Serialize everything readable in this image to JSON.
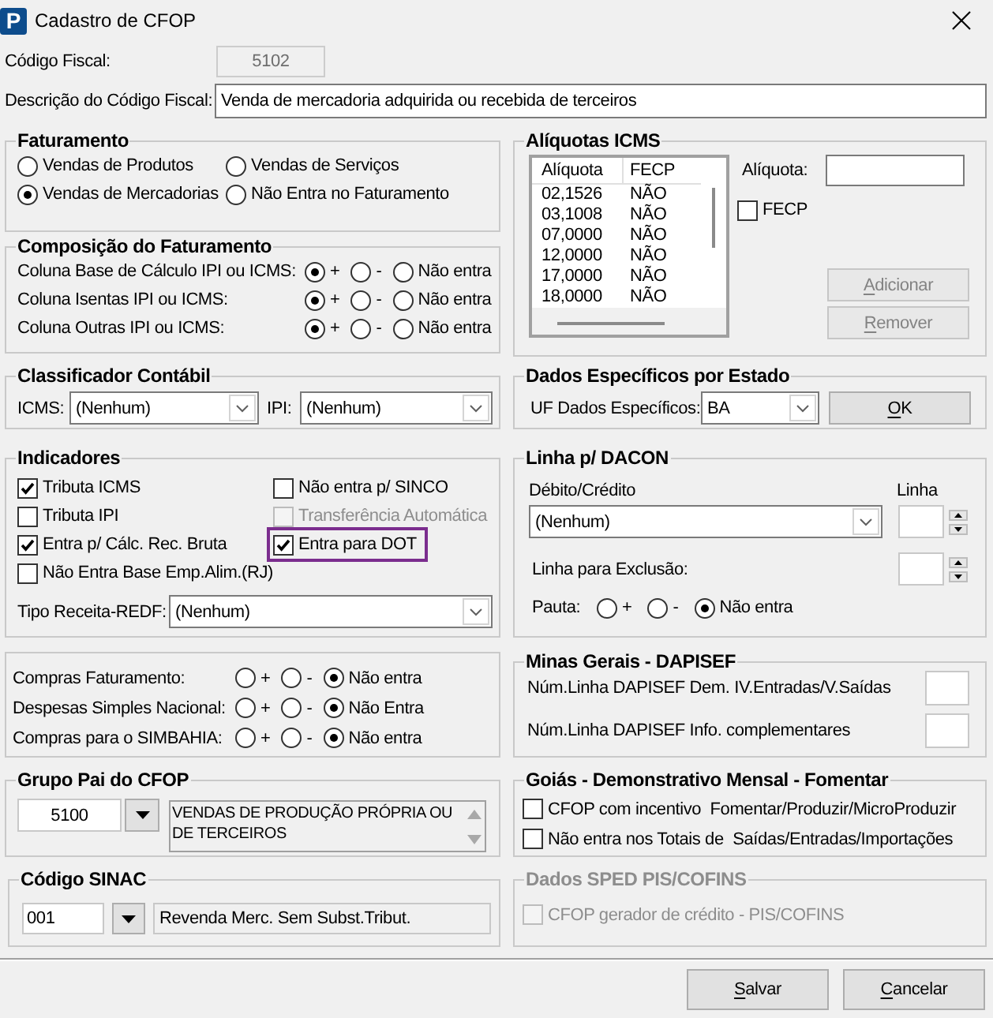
{
  "window": {
    "logo": "P",
    "title": "Cadastro de CFOP"
  },
  "header_fields": [
    {
      "label": "Código Fiscal:",
      "value": "5102",
      "disabled": true
    },
    {
      "label": "Descrição do Código Fiscal:",
      "value": "Venda de mercadoria adquirida ou recebida de terceiros",
      "disabled": false
    }
  ],
  "faturamento": {
    "title": "Faturamento",
    "options": [
      {
        "label": "Vendas de Produtos",
        "selected": false
      },
      {
        "label": "Vendas de Serviços",
        "selected": false
      },
      {
        "label": "Vendas de Mercadorias",
        "selected": true
      },
      {
        "label": "Não Entra no Faturamento",
        "selected": false
      }
    ]
  },
  "composicao": {
    "title": "Composição do Faturamento",
    "rows": [
      {
        "label": "Coluna Base de Cálculo IPI ou ICMS:",
        "options": [
          {
            "label": "+",
            "selected": true
          },
          {
            "label": "-",
            "selected": false
          },
          {
            "label": "Não entra",
            "selected": false
          }
        ]
      },
      {
        "label": "Coluna Isentas IPI ou ICMS:",
        "options": [
          {
            "label": "+",
            "selected": true
          },
          {
            "label": "-",
            "selected": false
          },
          {
            "label": "Não entra",
            "selected": false
          }
        ]
      },
      {
        "label": "Coluna Outras IPI ou ICMS:",
        "options": [
          {
            "label": "+",
            "selected": true
          },
          {
            "label": "-",
            "selected": false
          },
          {
            "label": "Não entra",
            "selected": false
          }
        ]
      }
    ]
  },
  "aliquotas_icms": {
    "title": "Alíquotas ICMS",
    "table": {
      "columns": [
        "Alíquota",
        "FECP"
      ],
      "rows": [
        [
          "02,1526",
          "NÃO"
        ],
        [
          "03,1008",
          "NÃO"
        ],
        [
          "07,0000",
          "NÃO"
        ],
        [
          "12,0000",
          "NÃO"
        ],
        [
          "17,0000",
          "NÃO"
        ],
        [
          "18,0000",
          "NÃO"
        ]
      ]
    },
    "aliquota_field": {
      "label": "Alíquota:"
    },
    "fecp": {
      "label": "FECP",
      "checked": false
    },
    "buttons": [
      {
        "label": "Adicionar",
        "disabled": true,
        "mnemonic": true
      },
      {
        "label": "Remover",
        "disabled": true,
        "mnemonic": true
      }
    ]
  },
  "classificador_contabil": {
    "title": "Classificador Contábil",
    "fields": [
      {
        "label": "ICMS:",
        "value": "(Nenhum)"
      },
      {
        "label": "IPI:",
        "value": "(Nenhum)"
      }
    ]
  },
  "dados_por_estado": {
    "title": "Dados Específicos por Estado",
    "label": "UF Dados Específicos:",
    "value": "BA",
    "button": {
      "label": "OK",
      "mnemonic": true,
      "disabled": false
    }
  },
  "indicadores": {
    "title": "Indicadores",
    "checkboxes": [
      {
        "label": "Tributa ICMS",
        "checked": true,
        "disabled": false,
        "highlighted": false
      },
      {
        "label": "Não entra p/ SINCO",
        "checked": false,
        "disabled": false,
        "highlighted": false
      },
      {
        "label": "Tributa IPI",
        "checked": false,
        "disabled": false,
        "highlighted": false
      },
      {
        "label": "Transferência Automática",
        "checked": false,
        "disabled": true,
        "highlighted": false
      },
      {
        "label": "Entra p/ Cálc. Rec. Bruta",
        "checked": true,
        "disabled": false,
        "highlighted": false
      },
      {
        "label": "Entra para DOT",
        "checked": true,
        "disabled": false,
        "highlighted": true
      },
      {
        "label": "Não Entra Base Emp.Alim.(RJ)",
        "checked": false,
        "disabled": false,
        "highlighted": false
      }
    ],
    "tipo_receita": {
      "label": "Tipo Receita-REDF:",
      "value": "(Nenhum)"
    }
  },
  "dacon": {
    "title": "Linha p/ DACON",
    "debito_credito": {
      "label": "Débito/Crédito",
      "value": "(Nenhum)"
    },
    "linha_label": "Linha",
    "exclusao_label": "Linha para Exclusão:",
    "pauta": {
      "label": "Pauta:",
      "options": [
        {
          "label": "+",
          "selected": false
        },
        {
          "label": "-",
          "selected": false
        },
        {
          "label": "Não entra",
          "selected": true
        }
      ]
    }
  },
  "compras": {
    "rows": [
      {
        "label": "Compras Faturamento:",
        "options": [
          {
            "label": "+",
            "selected": false
          },
          {
            "label": "-",
            "selected": false
          },
          {
            "label": "Não entra",
            "selected": true
          }
        ]
      },
      {
        "label": "Despesas Simples Nacional:",
        "options": [
          {
            "label": "+",
            "selected": false
          },
          {
            "label": "-",
            "selected": false
          },
          {
            "label": "Não Entra",
            "selected": true
          }
        ]
      },
      {
        "label": "Compras para o SIMBAHIA:",
        "options": [
          {
            "label": "+",
            "selected": false
          },
          {
            "label": "-",
            "selected": false
          },
          {
            "label": "Não entra",
            "selected": true
          }
        ]
      }
    ]
  },
  "minas_gerais": {
    "title": "Minas Gerais - DAPISEF",
    "fields": [
      {
        "label": "Núm.Linha DAPISEF Dem. IV.Entradas/V.Saídas"
      },
      {
        "label": "Núm.Linha DAPISEF Info. complementares"
      }
    ]
  },
  "grupo_pai": {
    "title": "Grupo Pai do CFOP",
    "code": "5100",
    "description": "VENDAS DE PRODUÇÃO PRÓPRIA OU DE TERCEIROS"
  },
  "goias": {
    "title": "Goiás - Demonstrativo Mensal - Fomentar",
    "checkboxes": [
      {
        "label": "CFOP com incentivo  Fomentar/Produzir/MicroProduzir",
        "checked": false
      },
      {
        "label": "Não entra nos Totais de  Saídas/Entradas/Importações",
        "checked": false
      }
    ]
  },
  "codigo_sinac": {
    "title": "Código SINAC",
    "code": "001",
    "description": "Revenda Merc. Sem Subst.Tribut."
  },
  "sped_pis_cofins": {
    "title": "Dados SPED PIS/COFINS",
    "disabled": true,
    "checkboxes": [
      {
        "label": "CFOP gerador de crédito - PIS/COFINS",
        "checked": false,
        "disabled": true
      }
    ]
  },
  "buttons": [
    {
      "label": "Salvar",
      "mnemonic": true
    },
    {
      "label": "Cancelar",
      "mnemonic": true
    }
  ]
}
